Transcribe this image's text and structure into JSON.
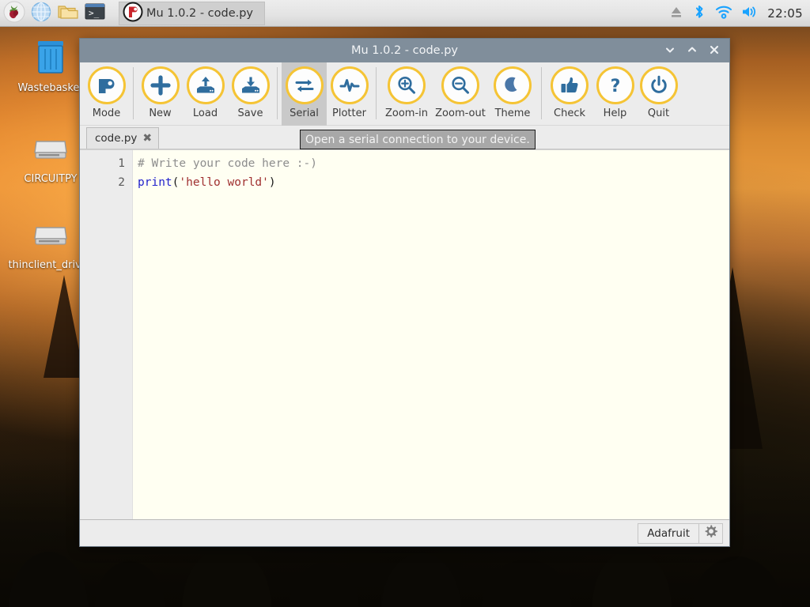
{
  "desktop": {
    "icons": [
      {
        "name": "wastebasket",
        "label": "Wastebasket",
        "icon": "trash-icon"
      },
      {
        "name": "circuitpy",
        "label": "CIRCUITPY",
        "icon": "drive-icon"
      },
      {
        "name": "thinclient-drives",
        "label": "thinclient_drives",
        "icon": "drive-icon"
      }
    ]
  },
  "taskbar": {
    "launchers": [
      {
        "name": "raspberry-menu",
        "icon": "raspberry-icon"
      },
      {
        "name": "web-browser",
        "icon": "globe-icon"
      },
      {
        "name": "file-manager",
        "icon": "folder-icon"
      },
      {
        "name": "terminal",
        "icon": "terminal-icon"
      }
    ],
    "task_button_label": "Mu 1.0.2 - code.py",
    "task_button_icon": "mu-icon",
    "tray": [
      {
        "name": "eject",
        "icon": "eject-icon"
      },
      {
        "name": "bluetooth",
        "icon": "bluetooth-icon"
      },
      {
        "name": "wifi",
        "icon": "wifi-icon"
      },
      {
        "name": "volume",
        "icon": "volume-icon"
      }
    ],
    "clock": "22:05"
  },
  "window": {
    "title": "Mu 1.0.2 - code.py",
    "controls": {
      "minimize": "⌄",
      "maximize": "⌃",
      "close": "✕"
    }
  },
  "toolbar": {
    "buttons": [
      {
        "name": "mode",
        "label": "Mode",
        "icon": "mode-icon",
        "active": false
      },
      {
        "name": "new",
        "label": "New",
        "icon": "plus-icon",
        "active": false
      },
      {
        "name": "load",
        "label": "Load",
        "icon": "upload-icon",
        "active": false
      },
      {
        "name": "save",
        "label": "Save",
        "icon": "download-icon",
        "active": false
      },
      {
        "name": "serial",
        "label": "Serial",
        "icon": "exchange-icon",
        "active": true
      },
      {
        "name": "plotter",
        "label": "Plotter",
        "icon": "pulse-icon",
        "active": false
      },
      {
        "name": "zoom-in",
        "label": "Zoom-in",
        "icon": "zoom-in-icon",
        "active": false
      },
      {
        "name": "zoom-out",
        "label": "Zoom-out",
        "icon": "zoom-out-icon",
        "active": false
      },
      {
        "name": "theme",
        "label": "Theme",
        "icon": "moon-icon",
        "active": false
      },
      {
        "name": "check",
        "label": "Check",
        "icon": "thumbs-up-icon",
        "active": false
      },
      {
        "name": "help",
        "label": "Help",
        "icon": "question-icon",
        "active": false
      },
      {
        "name": "quit",
        "label": "Quit",
        "icon": "power-icon",
        "active": false
      }
    ],
    "accent_color": "#f5c435",
    "icon_color": "#2f6d9e"
  },
  "tabs": {
    "items": [
      {
        "name": "code-py",
        "label": "code.py",
        "close_glyph": "✖"
      }
    ]
  },
  "tooltip": {
    "text": "Open a serial connection to your device."
  },
  "editor": {
    "line_numbers": [
      "1",
      "2"
    ],
    "lines": [
      {
        "segments": [
          {
            "text": "# Write your code here :-)",
            "style": "comment"
          }
        ]
      },
      {
        "segments": [
          {
            "text": "print",
            "style": "kw"
          },
          {
            "text": "(",
            "style": "plain"
          },
          {
            "text": "'hello world'",
            "style": "str"
          },
          {
            "text": ")",
            "style": "plain"
          }
        ]
      }
    ]
  },
  "statusbar": {
    "mode_label": "Adafruit",
    "settings_icon": "gear-icon"
  }
}
